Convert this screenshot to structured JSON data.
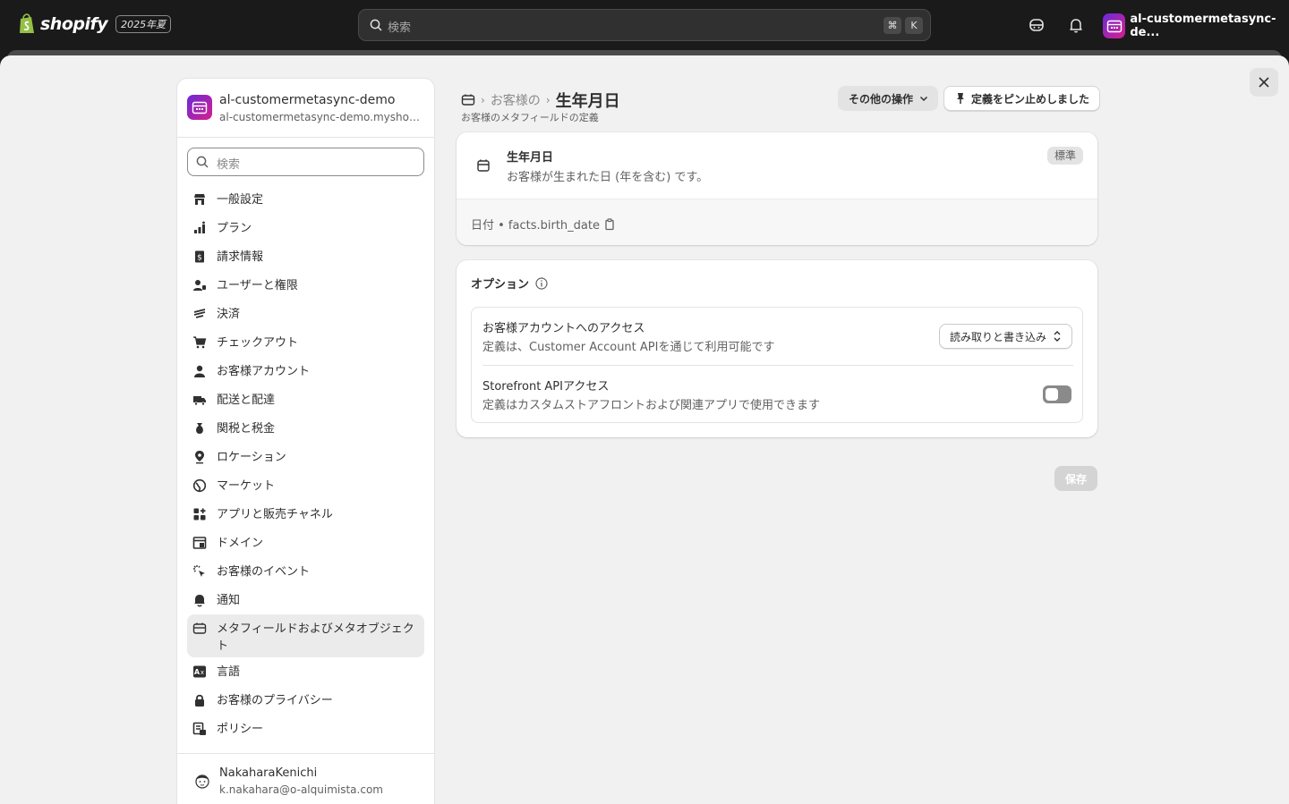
{
  "topbar": {
    "logo_text": "shopify",
    "edition": "2025年夏",
    "search_placeholder": "検索",
    "kbd_cmd": "⌘",
    "kbd_k": "K",
    "store_name": "al-customermetasync-de..."
  },
  "sidebar": {
    "store_title": "al-customermetasync-demo",
    "store_domain": "al-customermetasync-demo.myshopi...",
    "search_placeholder": "検索",
    "items": [
      {
        "label": "一般設定",
        "icon": "store-icon"
      },
      {
        "label": "プラン",
        "icon": "plan-icon"
      },
      {
        "label": "請求情報",
        "icon": "billing-icon"
      },
      {
        "label": "ユーザーと権限",
        "icon": "users-icon"
      },
      {
        "label": "決済",
        "icon": "payments-icon"
      },
      {
        "label": "チェックアウト",
        "icon": "cart-icon"
      },
      {
        "label": "お客様アカウント",
        "icon": "person-icon"
      },
      {
        "label": "配送と配達",
        "icon": "truck-icon"
      },
      {
        "label": "関税と税金",
        "icon": "tax-icon"
      },
      {
        "label": "ロケーション",
        "icon": "location-icon"
      },
      {
        "label": "マーケット",
        "icon": "globe-icon"
      },
      {
        "label": "アプリと販売チャネル",
        "icon": "apps-icon"
      },
      {
        "label": "ドメイン",
        "icon": "domain-icon"
      },
      {
        "label": "お客様のイベント",
        "icon": "events-icon"
      },
      {
        "label": "通知",
        "icon": "bell-icon"
      },
      {
        "label": "メタフィールドおよびメタオブジェクト",
        "icon": "metafields-icon"
      },
      {
        "label": "言語",
        "icon": "language-icon"
      },
      {
        "label": "お客様のプライバシー",
        "icon": "lock-icon"
      },
      {
        "label": "ポリシー",
        "icon": "policy-icon"
      }
    ],
    "user_name": "NakaharaKenichi",
    "user_email": "k.nakahara@o-alquimista.com"
  },
  "header": {
    "crumb_parent": "お客様の",
    "title": "生年月日",
    "subtitle": "お客様のメタフィールドの定義",
    "more_actions": "その他の操作",
    "pinned": "定義をピン止めしました"
  },
  "definition": {
    "name": "生年月日",
    "description": "お客様が生まれた日 (年を含む) です。",
    "badge": "標準",
    "type_label": "日付 • facts.birth_date"
  },
  "options": {
    "title": "オプション",
    "customer_access_title": "お客様アカウントへのアクセス",
    "customer_access_desc": "定義は、Customer Account APIを通じて利用可能です",
    "customer_access_value": "読み取りと書き込み",
    "storefront_title": "Storefront APIアクセス",
    "storefront_desc": "定義はカスタムストアフロントおよび関連アプリで使用できます",
    "storefront_enabled": false
  },
  "save_label": "保存"
}
